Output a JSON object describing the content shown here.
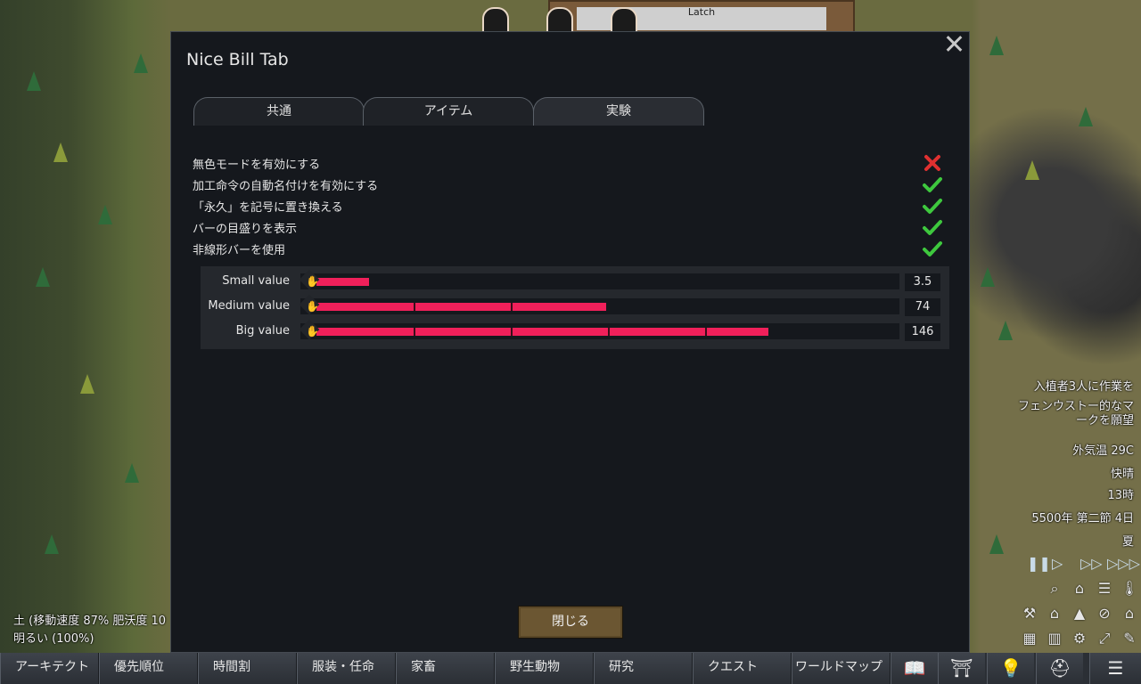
{
  "world": {
    "building_label": "Latch"
  },
  "dialog": {
    "title": "Nice Bill Tab",
    "tabs": [
      {
        "label": "共通",
        "active": false
      },
      {
        "label": "アイテム",
        "active": false
      },
      {
        "label": "実験",
        "active": true
      }
    ],
    "options": [
      {
        "label": "無色モードを有効にする",
        "enabled": false
      },
      {
        "label": "加工命令の自動名付けを有効にする",
        "enabled": true
      },
      {
        "label": "「永久」を記号に置き換える",
        "enabled": true
      },
      {
        "label": "バーの目盛りを表示",
        "enabled": true
      },
      {
        "label": "非線形バーを使用",
        "enabled": true
      }
    ],
    "sliders": [
      {
        "label": "Small value",
        "value": "3.5",
        "fill_fraction": 0.09,
        "ticks": 0
      },
      {
        "label": "Medium value",
        "value": "74",
        "fill_fraction": 0.5,
        "ticks": 2
      },
      {
        "label": "Big value",
        "value": "146",
        "fill_fraction": 0.78,
        "ticks": 4
      }
    ],
    "close_label": "閉じる"
  },
  "hud": {
    "alert_line1": "入植者3人に作業を",
    "alert_line2": "フェンウストー的なマ",
    "alert_line3": "ークを願望",
    "temperature": "外気温 29C",
    "comfort": "快晴",
    "hour": "13時",
    "date": "5500年 第二節 4日",
    "season": "夏"
  },
  "left_info": {
    "terrain": "土 (移動速度 87% 肥沃度 10",
    "light": "明るい (100%)"
  },
  "colors": {
    "check_green": "#3ec83e",
    "cross_red": "#e03030",
    "bar_fill": "#f0205a",
    "button_brown": "#6b5632"
  },
  "bottombar": {
    "buttons": [
      "アーキテクト",
      "優先順位",
      "時間割",
      "服装・任命",
      "家畜",
      "野生動物",
      "研究",
      "クエスト",
      "ワールドマップ"
    ],
    "icons": [
      "book-icon",
      "hierarchy-icon",
      "lightbulb-icon",
      "helmet-icon",
      "menu-icon"
    ]
  }
}
